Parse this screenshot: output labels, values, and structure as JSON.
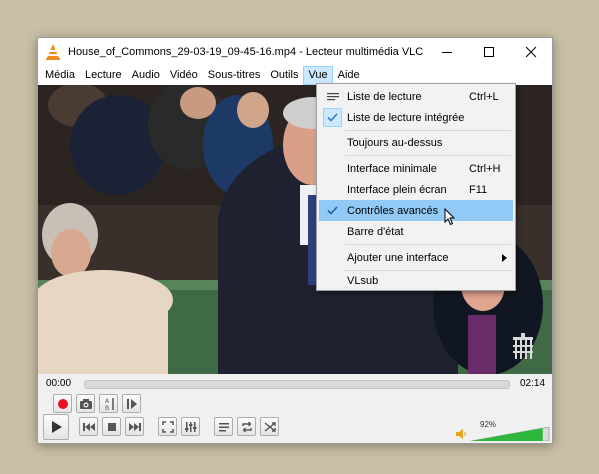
{
  "window": {
    "title": "House_of_Commons_29-03-19_09-45-16.mp4 - Lecteur multimédia VLC"
  },
  "menubar": {
    "items": [
      "Média",
      "Lecture",
      "Audio",
      "Vidéo",
      "Sous-titres",
      "Outils",
      "Vue",
      "Aide"
    ],
    "active": "Vue"
  },
  "view_menu": {
    "items": [
      {
        "label": "Liste de lecture",
        "shortcut": "Ctrl+L",
        "icon": "playlist-icon"
      },
      {
        "label": "Liste de lecture intégrée",
        "shortcut": "",
        "checked": true
      },
      {
        "label": "Toujours au-dessus",
        "shortcut": ""
      },
      {
        "label": "Interface minimale",
        "shortcut": "Ctrl+H"
      },
      {
        "label": "Interface plein écran",
        "shortcut": "F11"
      },
      {
        "label": "Contrôles avancés",
        "shortcut": "",
        "checked": true,
        "highlighted": true
      },
      {
        "label": "Barre d'état",
        "shortcut": ""
      },
      {
        "label": "Ajouter une interface",
        "shortcut": "",
        "submenu": true
      },
      {
        "label": "VLsub",
        "shortcut": ""
      }
    ]
  },
  "player": {
    "elapsed": "00:00",
    "total": "02:14",
    "progress": 0,
    "volume_label": "92%",
    "volume": 0.92
  },
  "colors": {
    "highlight": "#91c9f7",
    "volume_green": "#2db83d",
    "record_red": "#e81123",
    "accent_blue": "#2d7bd0"
  }
}
